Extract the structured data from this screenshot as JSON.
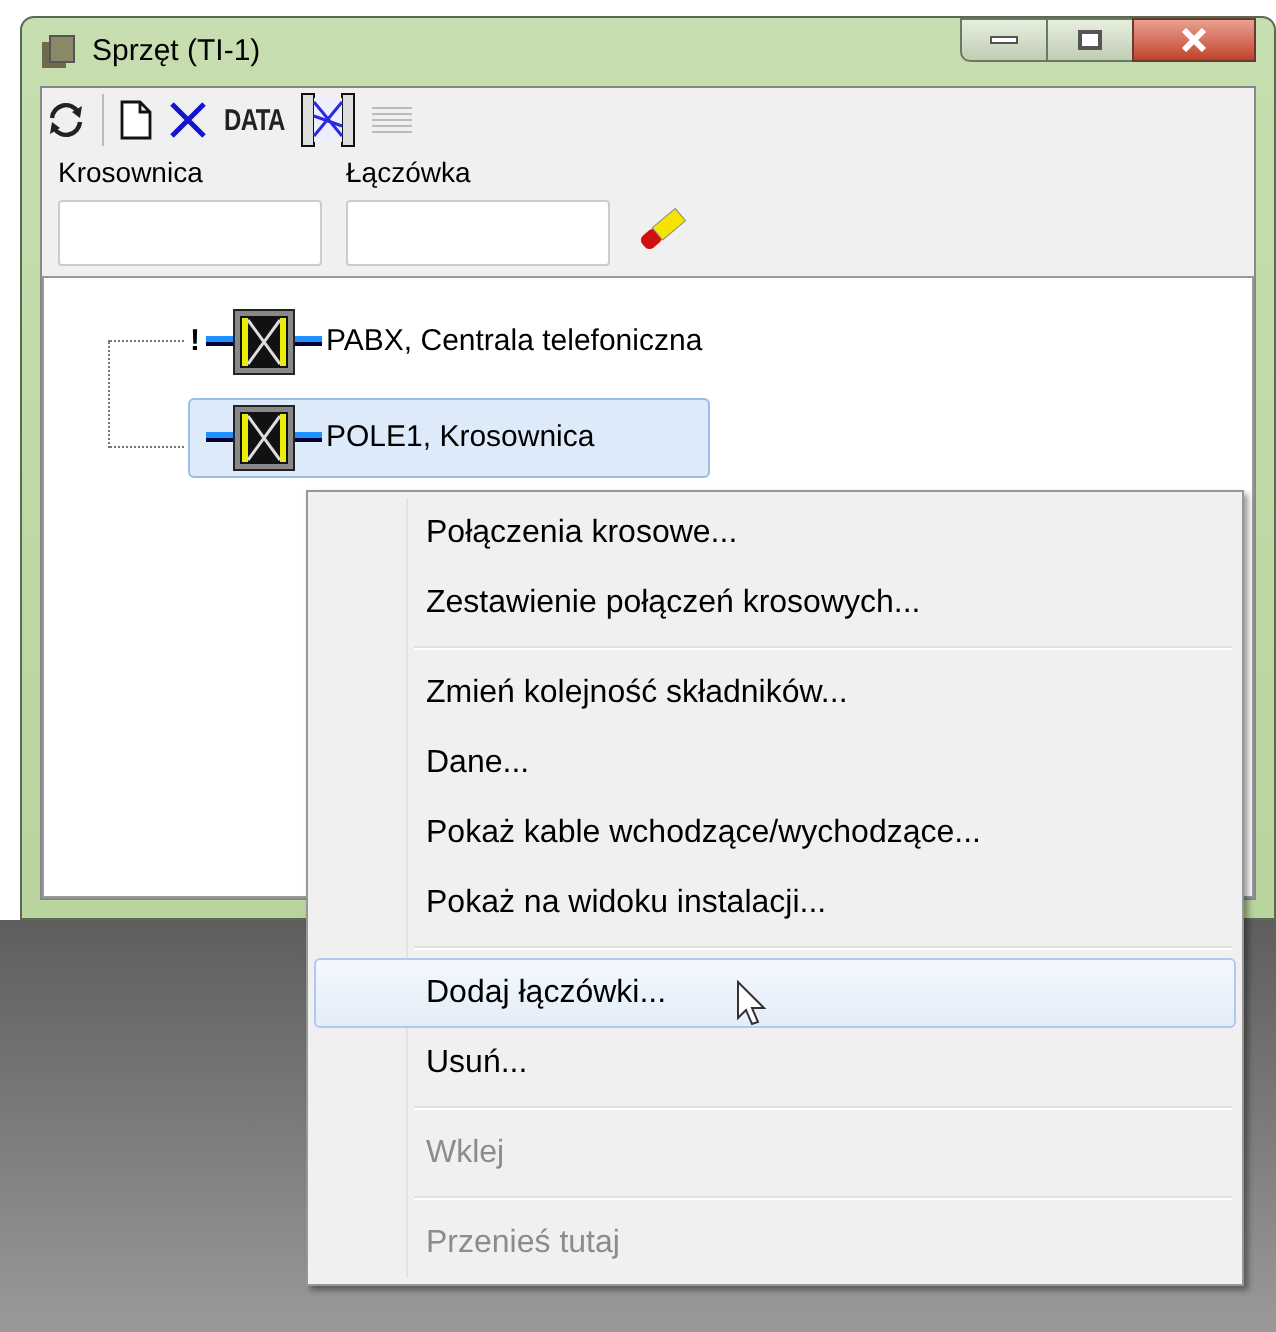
{
  "window": {
    "title": "Sprzęt (TI-1)"
  },
  "toolbar": {
    "data_label": "DATA"
  },
  "filters": [
    {
      "label": "Krosownica"
    },
    {
      "label": "Łączówka"
    }
  ],
  "tree": {
    "items": [
      {
        "label": "PABX, Centrala telefoniczna",
        "marker": "!",
        "selected": false
      },
      {
        "label": "POLE1, Krosownica",
        "selected": true
      }
    ]
  },
  "context_menu": {
    "groups": [
      [
        {
          "label": "Połączenia krosowe...",
          "disabled": false,
          "selected": false
        },
        {
          "label": "Zestawienie połączeń krosowych...",
          "disabled": false,
          "selected": false
        }
      ],
      [
        {
          "label": "Zmień kolejność składników...",
          "disabled": false,
          "selected": false
        },
        {
          "label": "Dane...",
          "disabled": false,
          "selected": false
        },
        {
          "label": "Pokaż kable wchodzące/wychodzące...",
          "disabled": false,
          "selected": false
        },
        {
          "label": "Pokaż na widoku instalacji...",
          "disabled": false,
          "selected": false
        }
      ],
      [
        {
          "label": "Dodaj łączówki...",
          "disabled": false,
          "selected": true
        },
        {
          "label": "Usuń...",
          "disabled": false,
          "selected": false
        }
      ],
      [
        {
          "label": "Wklej",
          "disabled": true,
          "selected": false
        }
      ],
      [
        {
          "label": "Przenieś tutaj",
          "disabled": true,
          "selected": false
        }
      ]
    ]
  }
}
